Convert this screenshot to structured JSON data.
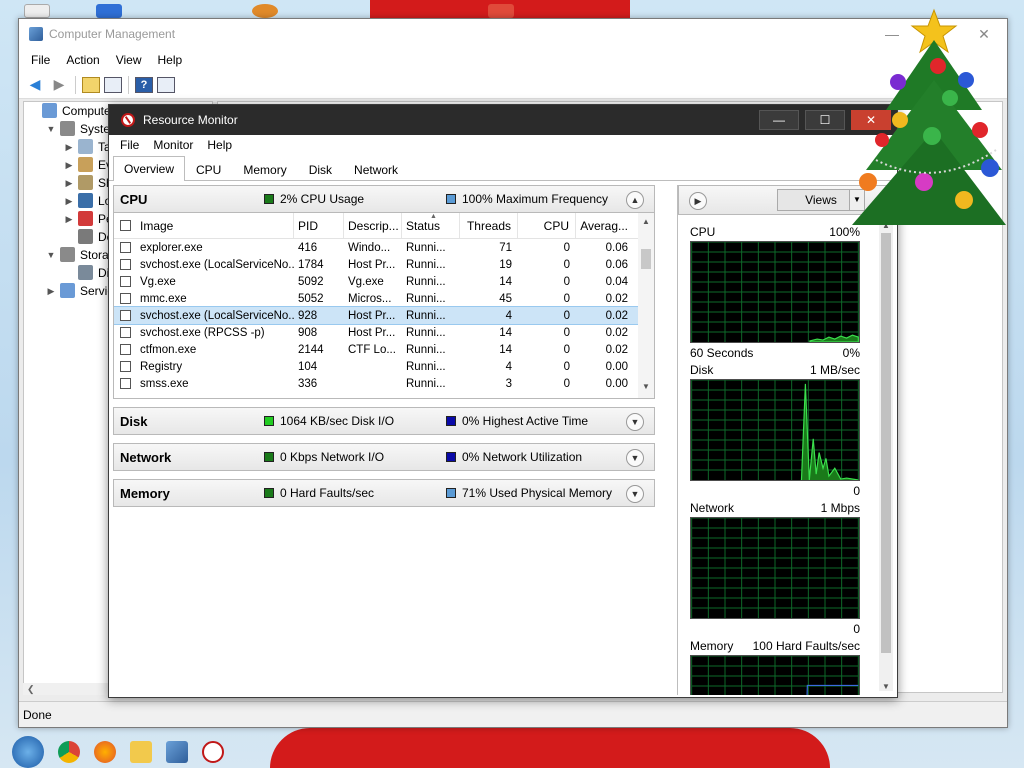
{
  "computer_management": {
    "title": "Computer Management",
    "menu": [
      "File",
      "Action",
      "View",
      "Help"
    ],
    "tree": [
      {
        "label": "Computer M",
        "indent": 0,
        "arrow": ""
      },
      {
        "label": "System",
        "indent": 1,
        "arrow": "open"
      },
      {
        "label": "Task",
        "indent": 2,
        "arrow": "closed"
      },
      {
        "label": "Ever",
        "indent": 2,
        "arrow": "closed"
      },
      {
        "label": "Shar",
        "indent": 2,
        "arrow": "closed"
      },
      {
        "label": "Loca",
        "indent": 2,
        "arrow": "closed"
      },
      {
        "label": "Perfo",
        "indent": 2,
        "arrow": "closed"
      },
      {
        "label": "Devi",
        "indent": 2,
        "arrow": ""
      },
      {
        "label": "Storage",
        "indent": 1,
        "arrow": "open"
      },
      {
        "label": "Disk",
        "indent": 2,
        "arrow": ""
      },
      {
        "label": "Services",
        "indent": 1,
        "arrow": "closed"
      }
    ],
    "status": "Done"
  },
  "resource_monitor": {
    "title": "Resource Monitor",
    "menu": [
      "File",
      "Monitor",
      "Help"
    ],
    "tabs": [
      "Overview",
      "CPU",
      "Memory",
      "Disk",
      "Network"
    ],
    "cpu": {
      "title": "CPU",
      "stat1": "2% CPU Usage",
      "stat1_color": "#1a7a1a",
      "stat2": "100% Maximum Frequency",
      "stat2_color": "#5b9bd5",
      "columns": [
        "Image",
        "PID",
        "Descrip...",
        "Status",
        "Threads",
        "CPU",
        "Averag..."
      ],
      "rows": [
        {
          "image": "explorer.exe",
          "pid": "416",
          "desc": "Windo...",
          "status": "Runni...",
          "threads": "71",
          "cpu": "0",
          "avg": "0.06",
          "selected": false
        },
        {
          "image": "svchost.exe (LocalServiceNo...",
          "pid": "1784",
          "desc": "Host Pr...",
          "status": "Runni...",
          "threads": "19",
          "cpu": "0",
          "avg": "0.06",
          "selected": false
        },
        {
          "image": "Vg.exe",
          "pid": "5092",
          "desc": "Vg.exe",
          "status": "Runni...",
          "threads": "14",
          "cpu": "0",
          "avg": "0.04",
          "selected": false
        },
        {
          "image": "mmc.exe",
          "pid": "5052",
          "desc": "Micros...",
          "status": "Runni...",
          "threads": "45",
          "cpu": "0",
          "avg": "0.02",
          "selected": false
        },
        {
          "image": "svchost.exe (LocalServiceNo...",
          "pid": "928",
          "desc": "Host Pr...",
          "status": "Runni...",
          "threads": "4",
          "cpu": "0",
          "avg": "0.02",
          "selected": true
        },
        {
          "image": "svchost.exe (RPCSS -p)",
          "pid": "908",
          "desc": "Host Pr...",
          "status": "Runni...",
          "threads": "14",
          "cpu": "0",
          "avg": "0.02",
          "selected": false
        },
        {
          "image": "ctfmon.exe",
          "pid": "2144",
          "desc": "CTF Lo...",
          "status": "Runni...",
          "threads": "14",
          "cpu": "0",
          "avg": "0.02",
          "selected": false
        },
        {
          "image": "Registry",
          "pid": "104",
          "desc": "",
          "status": "Runni...",
          "threads": "4",
          "cpu": "0",
          "avg": "0.00",
          "selected": false
        },
        {
          "image": "smss.exe",
          "pid": "336",
          "desc": "",
          "status": "Runni...",
          "threads": "3",
          "cpu": "0",
          "avg": "0.00",
          "selected": false
        }
      ]
    },
    "disk": {
      "title": "Disk",
      "stat1": "1064 KB/sec Disk I/O",
      "stat1_color": "#22cc22",
      "stat2": "0% Highest Active Time",
      "stat2_color": "#0a0aa8"
    },
    "network": {
      "title": "Network",
      "stat1": "0 Kbps Network I/O",
      "stat1_color": "#1a7a1a",
      "stat2": "0% Network Utilization",
      "stat2_color": "#0a0aa8"
    },
    "memory": {
      "title": "Memory",
      "stat1": "0 Hard Faults/sec",
      "stat1_color": "#1a7a1a",
      "stat2": "71% Used Physical Memory",
      "stat2_color": "#5b9bd5"
    },
    "graphs": {
      "views_label": "Views",
      "cpu": {
        "label": "CPU",
        "max": "100%",
        "footer_left": "60 Seconds",
        "footer_right": "0%"
      },
      "disk": {
        "label": "Disk",
        "max": "1 MB/sec",
        "footer_right": "0"
      },
      "network": {
        "label": "Network",
        "max": "1 Mbps",
        "footer_right": "0"
      },
      "memory": {
        "label": "Memory",
        "max": "100 Hard Faults/sec"
      }
    }
  }
}
